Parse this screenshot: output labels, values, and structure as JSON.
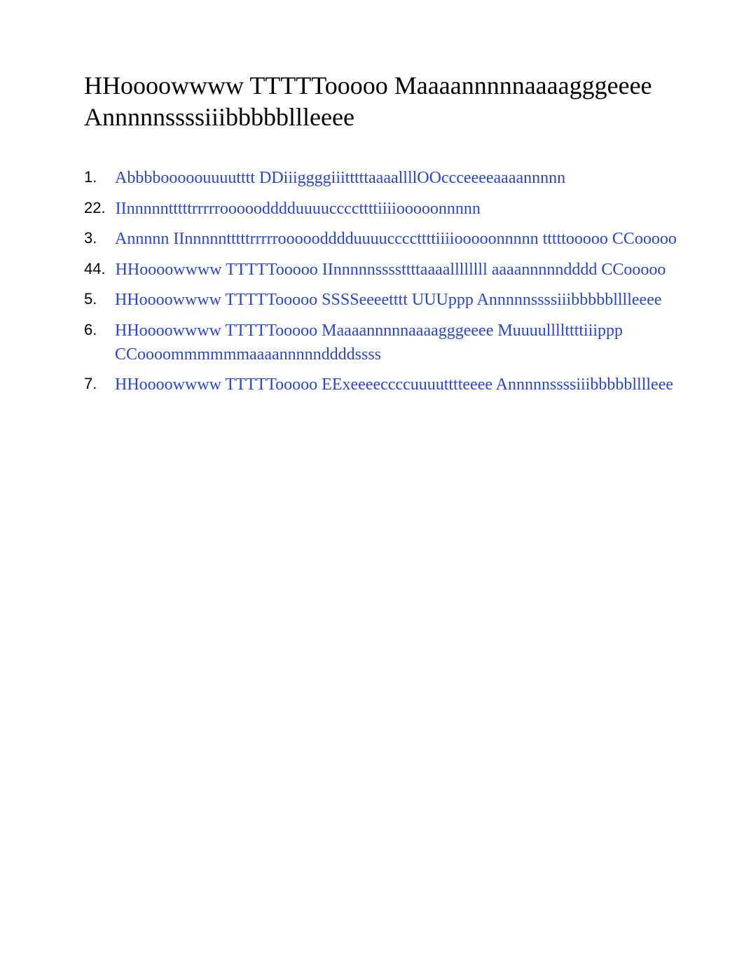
{
  "title_line1": "HHoooowwww TTTTTooooo Maaaannnnnaaaagggeeee",
  "title_line2": "Annnnnssssiiibbbbbllleeee",
  "toc": [
    {
      "number": "1.",
      "label": "Abbbbooooouuuutttt DDiiiggggiiitttttaaaallllOOccceeeeaaaannnnn"
    },
    {
      "number": "22.",
      "label": "IInnnnntttttrrrrrooooodddduuuuccccttttiiiiooooonnnnn"
    },
    {
      "number": "3.",
      "label": "Annnnn IInnnnntttttrrrrrooooodddduuuuccccttttiiiiooooonnnnn tttttooooo CCooooo"
    },
    {
      "number": "44.",
      "label": "HHoooowwww TTTTTooooo IInnnnnssssttttaaaallllllll aaaannnnndddd CCooooo"
    },
    {
      "number": "5.",
      "label": "HHoooowwww TTTTTooooo SSSSeeeetttt UUUppp Annnnnssssiiibbbbblllleeee"
    },
    {
      "number": "6.",
      "label_line1": "HHoooowwww   TTTTTooooo   Maaaannnnnaaaagggeeee   Muuuullllttttiiippp",
      "label_line2": "CCoooommmmmmaaaannnnnddddssss"
    },
    {
      "number": "7.",
      "label": "HHoooowwww TTTTTooooo EExeeeeccccuuuutttteeee Annnnnssssiiibbbbblllleee"
    }
  ]
}
